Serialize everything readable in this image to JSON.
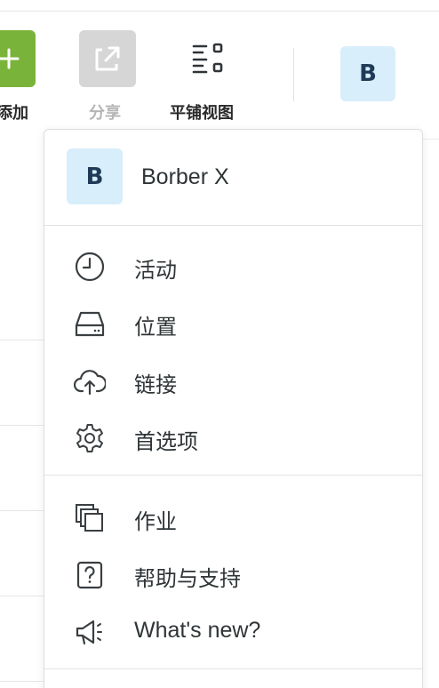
{
  "toolbar": {
    "add_label": "添加",
    "share_label": "分享",
    "tile_view_label": "平铺视图",
    "avatar_initial": "B"
  },
  "menu": {
    "user": {
      "initial": "B",
      "name": "Borber X"
    },
    "items": [
      {
        "label": "活动",
        "icon": "clock-icon"
      },
      {
        "label": "位置",
        "icon": "drive-icon"
      },
      {
        "label": "链接",
        "icon": "cloud-upload-icon"
      },
      {
        "label": "首选项",
        "icon": "gear-icon"
      },
      {
        "label": "作业",
        "icon": "stacked-copies-icon"
      },
      {
        "label": "帮助与支持",
        "icon": "help-icon"
      },
      {
        "label": "What's new?",
        "icon": "megaphone-icon"
      }
    ]
  },
  "colors": {
    "add_green": "#7ab33a",
    "share_gray": "#d6d6d6",
    "avatar_bg": "#d8eefa",
    "avatar_text": "#1f3b57"
  }
}
